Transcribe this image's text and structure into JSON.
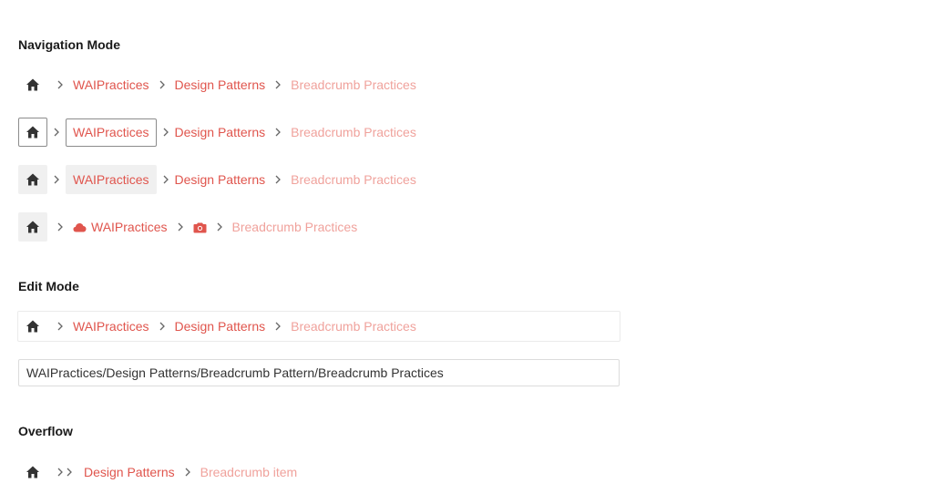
{
  "sections": {
    "navigation_mode": "Navigation Mode",
    "edit_mode": "Edit Mode",
    "overflow": "Overflow"
  },
  "nav_rows": [
    {
      "items": [
        "WAIPractices",
        "Design Patterns"
      ],
      "current": "Breadcrumb Practices"
    },
    {
      "items": [
        "WAIPractices",
        "Design Patterns"
      ],
      "current": "Breadcrumb Practices"
    },
    {
      "items": [
        "WAIPractices",
        "Design Patterns"
      ],
      "current": "Breadcrumb Practices"
    },
    {
      "items": [
        "WAIPractices"
      ],
      "current": "Breadcrumb Practices",
      "icons": [
        "cloud-icon",
        "camera-icon"
      ]
    }
  ],
  "edit": {
    "items": [
      "WAIPractices",
      "Design Patterns"
    ],
    "current": "Breadcrumb Practices",
    "path_value": "WAIPractices/Design Patterns/Breadcrumb Pattern/Breadcrumb Practices"
  },
  "overflow_row": {
    "items": [
      "Design Patterns"
    ],
    "current": "Breadcrumb item"
  },
  "colors": {
    "link": "#e0554d",
    "current": "#f0a29c",
    "icon": "#333333"
  }
}
